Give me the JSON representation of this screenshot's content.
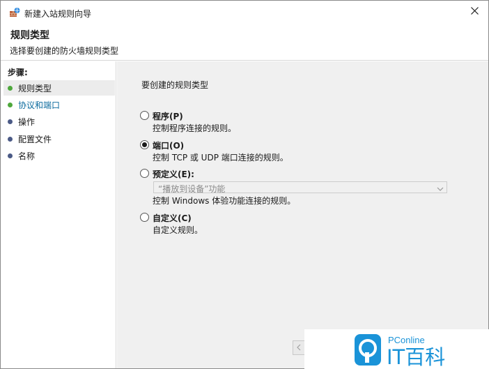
{
  "window": {
    "title": "新建入站规则向导"
  },
  "header": {
    "title": "规则类型",
    "subtitle": "选择要创建的防火墙规则类型"
  },
  "steps": {
    "heading": "步骤:",
    "items": [
      {
        "label": "规则类型",
        "state": "current",
        "bullet_color": "#4ea83c"
      },
      {
        "label": "协议和端口",
        "state": "link",
        "bullet_color": "#4ea83c"
      },
      {
        "label": "操作",
        "state": "pending",
        "bullet_color": "#4b5a86"
      },
      {
        "label": "配置文件",
        "state": "pending",
        "bullet_color": "#4b5a86"
      },
      {
        "label": "名称",
        "state": "pending",
        "bullet_color": "#4b5a86"
      }
    ]
  },
  "content": {
    "prompt": "要创建的规则类型",
    "options": [
      {
        "label": "程序(P)",
        "description": "控制程序连接的规则。",
        "checked": false
      },
      {
        "label": "端口(O)",
        "description": "控制 TCP 或 UDP 端口连接的规则。",
        "checked": true
      },
      {
        "label": "预定义(E):",
        "checked": false
      },
      {
        "label": "自定义(C)",
        "description": "自定义规则。",
        "checked": false
      }
    ],
    "predefined": {
      "selected": "“播放到设备”功能",
      "description": "控制 Windows 体验功能连接的规则。"
    }
  },
  "watermark": {
    "brand": "PConline",
    "text": "IT百科"
  },
  "colors": {
    "accent_blue": "#0b6b9e",
    "watermark_blue": "#1a93d8"
  }
}
